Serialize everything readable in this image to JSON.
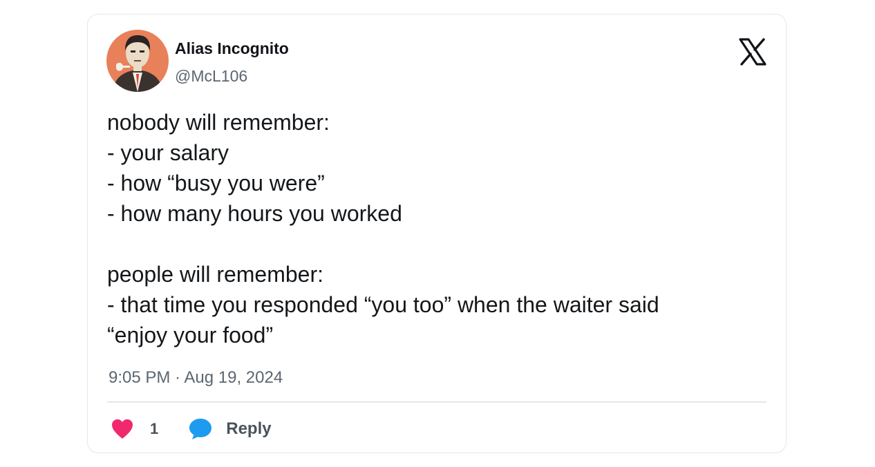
{
  "author": {
    "display_name": "Alias Incognito",
    "handle": "@McL106",
    "avatar_icon": "profile-photo-avatar"
  },
  "platform_icon": "x-logo-icon",
  "tweet": {
    "lines": [
      "nobody will remember:",
      "- your salary",
      "- how “busy you were”",
      "- how many hours you worked",
      "",
      "people will remember:",
      "- that time you responded “you too” when the waiter said",
      "“enjoy your food”"
    ],
    "timestamp": "9:05 PM · Aug 19, 2024"
  },
  "actions": {
    "like_icon": "heart-icon",
    "like_count": "1",
    "reply_icon": "speech-bubble-icon",
    "reply_label": "Reply"
  },
  "colors": {
    "heart": "#f0296f",
    "reply": "#1d9bf0",
    "avatar_bg": "#e8805a",
    "border": "#e3e6e8",
    "text": "#14171a",
    "muted": "#5b6670"
  }
}
